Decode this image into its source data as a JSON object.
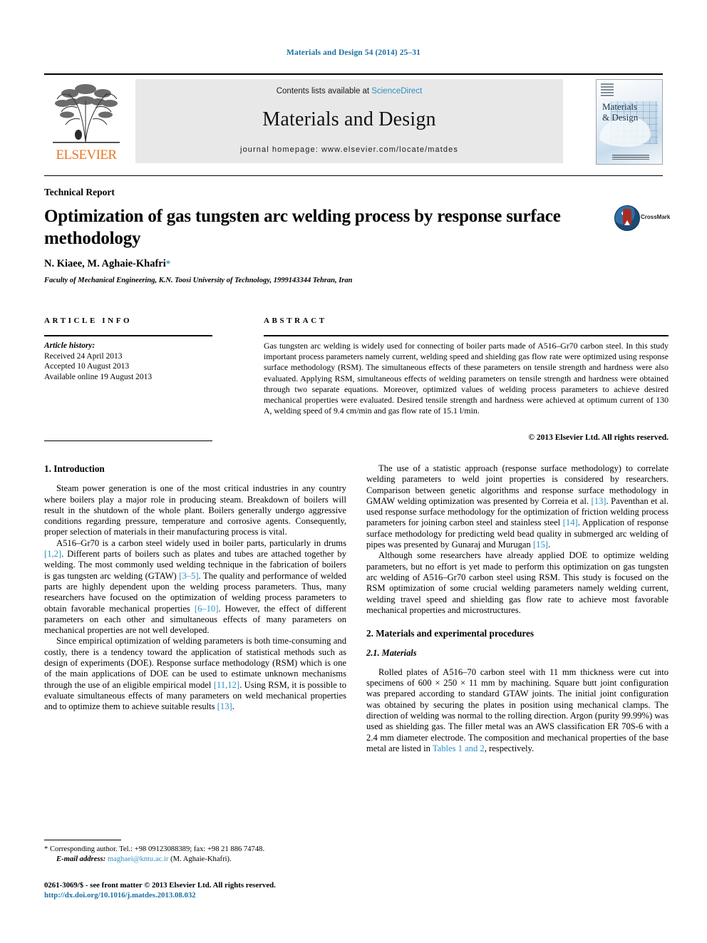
{
  "running_head": "Materials and Design 54 (2014) 25–31",
  "masthead": {
    "contents_prefix": "Contents lists available at ",
    "sciencedirect": "ScienceDirect",
    "journal_title": "Materials and Design",
    "homepage": "journal homepage: www.elsevier.com/locate/matdes",
    "publisher_name": "ELSEVIER",
    "cover_title_line1": "Materials",
    "cover_title_line2": "& Design"
  },
  "article": {
    "doctype": "Technical Report",
    "title": "Optimization of gas tungsten arc welding process by response surface methodology",
    "authors": "N. Kiaee, M. Aghaie-Khafri",
    "corresponding_marker": "*",
    "affiliation": "Faculty of Mechanical Engineering, K.N. Toosi University of Technology, 1999143344 Tehran, Iran",
    "crossmark_label": "CrossMark"
  },
  "info": {
    "heading": "ARTICLE INFO",
    "history_label": "Article history:",
    "received": "Received 24 April 2013",
    "accepted": "Accepted 10 August 2013",
    "available": "Available online 19 August 2013"
  },
  "abstract": {
    "heading": "ABSTRACT",
    "text": "Gas tungsten arc welding is widely used for connecting of boiler parts made of A516–Gr70 carbon steel. In this study important process parameters namely current, welding speed and shielding gas flow rate were optimized using response surface methodology (RSM). The simultaneous effects of these parameters on tensile strength and hardness were also evaluated. Applying RSM, simultaneous effects of welding parameters on tensile strength and hardness were obtained through two separate equations. Moreover, optimized values of welding process parameters to achieve desired mechanical properties were evaluated. Desired tensile strength and hardness were achieved at optimum current of 130 A, welding speed of 9.4 cm/min and gas flow rate of 15.1 l/min.",
    "copyright": "© 2013 Elsevier Ltd. All rights reserved."
  },
  "body": {
    "intro_heading": "1. Introduction",
    "p1": "Steam power generation is one of the most critical industries in any country where boilers play a major role in producing steam. Breakdown of boilers will result in the shutdown of the whole plant. Boilers generally undergo aggressive conditions regarding pressure, temperature and corrosive agents. Consequently, proper selection of materials in their manufacturing process is vital.",
    "p2_a": "A516–Gr70 is a carbon steel widely used in boiler parts, particularly in drums ",
    "p2_c1": "[1,2]",
    "p2_b": ". Different parts of boilers such as plates and tubes are attached together by welding. The most commonly used welding technique in the fabrication of boilers is gas tungsten arc welding (GTAW) ",
    "p2_c2": "[3–5]",
    "p2_d": ". The quality and performance of welded parts are highly dependent upon the welding process parameters. Thus, many researchers have focused on the optimization of welding process parameters to obtain favorable mechanical properties ",
    "p2_c3": "[6–10]",
    "p2_e": ". However, the effect of different parameters on each other and simultaneous effects of many parameters on mechanical properties are not well developed.",
    "p3_a": "Since empirical optimization of welding parameters is both time-consuming and costly, there is a tendency toward the application of statistical methods such as design of experiments (DOE). Response surface methodology (RSM) which is one of the main applications of DOE can be used to estimate unknown mechanisms through the use of an eligible empirical model ",
    "p3_c1": "[11,12]",
    "p3_b": ". Using RSM, it is possible to evaluate simultaneous effects of many parameters on weld mechanical properties and to optimize them to achieve suitable results ",
    "p3_c2": "[13]",
    "p3_c": ".",
    "p4_a": "The use of a statistic approach (response surface methodology) to correlate welding parameters to weld joint properties is considered by researchers. Comparison between genetic algorithms and response surface methodology in GMAW welding optimization was presented by Correia et al. ",
    "p4_c1": "[13]",
    "p4_b": ". Paventhan et al. used response surface methodology for the optimization of friction welding process parameters for joining carbon steel and stainless steel ",
    "p4_c2": "[14]",
    "p4_c": ". Application of response surface methodology for predicting weld bead quality in submerged arc welding of pipes was presented by Gunaraj and Murugan ",
    "p4_c3": "[15]",
    "p4_d": ".",
    "p5": "Although some researchers have already applied DOE to optimize welding parameters, but no effort is yet made to perform this optimization on gas tungsten arc welding of A516–Gr70 carbon steel using RSM. This study is focused on the RSM optimization of some crucial welding parameters namely welding current, welding travel speed and shielding gas flow rate to achieve most favorable mechanical properties and microstructures.",
    "sec2_heading": "2. Materials and experimental procedures",
    "sec21_heading": "2.1. Materials",
    "p6_a": "Rolled plates of A516–70 carbon steel with 11 mm thickness were cut into specimens of 600 × 250 × 11 mm by machining. Square butt joint configuration was prepared according to standard GTAW joints. The initial joint configuration was obtained by securing the plates in position using mechanical clamps. The direction of welding was normal to the rolling direction. Argon (purity 99.99%) was used as shielding gas. The filler metal was an AWS classification ER 70S-6 with a 2.4 mm diameter electrode. The composition and mechanical properties of the base metal are listed in ",
    "p6_c1": "Tables 1 and 2",
    "p6_b": ", respectively."
  },
  "footer": {
    "corresponding_star": "*",
    "corresponding_text": "Corresponding author. Tel.: +98 09123088389; fax: +98 21 886 74748.",
    "email_label": "E-mail address:",
    "email": "maghaei@kntu.ac.ir",
    "email_owner": "(M. Aghaie-Khafri).",
    "imprint": "0261-3069/$ - see front matter © 2013 Elsevier Ltd. All rights reserved.",
    "doi": "http://dx.doi.org/10.1016/j.matdes.2013.08.032"
  },
  "colors": {
    "link": "#2d8fc4",
    "runhead": "#1c6ea4",
    "elsevier_orange": "#E87722"
  }
}
